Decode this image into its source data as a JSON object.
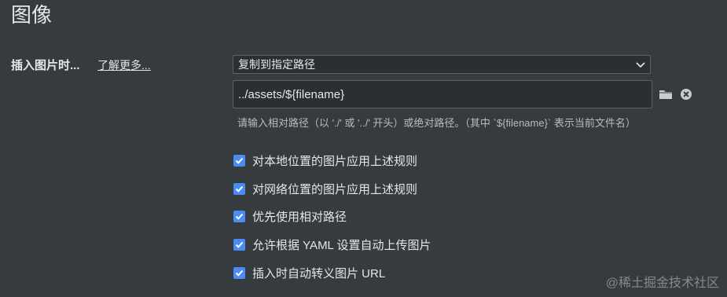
{
  "page": {
    "title": "图像"
  },
  "image_setting": {
    "label": "插入图片时...",
    "learn_more": "了解更多...",
    "select_value": "复制到指定路径",
    "path_value": "../assets/${filename}",
    "hint": "请输入相对路径（以 './' 或 '../' 开头）或绝对路径。（其中 `${filename}` 表示当前文件名）",
    "icons": {
      "folder": "folder-icon",
      "clear": "clear-icon",
      "dropdown": "chevron-down-icon"
    }
  },
  "options": [
    {
      "label": "对本地位置的图片应用上述规则",
      "checked": true
    },
    {
      "label": "对网络位置的图片应用上述规则",
      "checked": true
    },
    {
      "label": "优先使用相对路径",
      "checked": true
    },
    {
      "label": "允许根据 YAML 设置自动上传图片",
      "checked": true
    },
    {
      "label": "插入时自动转义图片 URL",
      "checked": true
    }
  ],
  "watermark": "@稀土掘金技术社区",
  "colors": {
    "background": "#363b40",
    "checkbox": "#4a8cf0",
    "input_bg": "#2b2f33"
  }
}
